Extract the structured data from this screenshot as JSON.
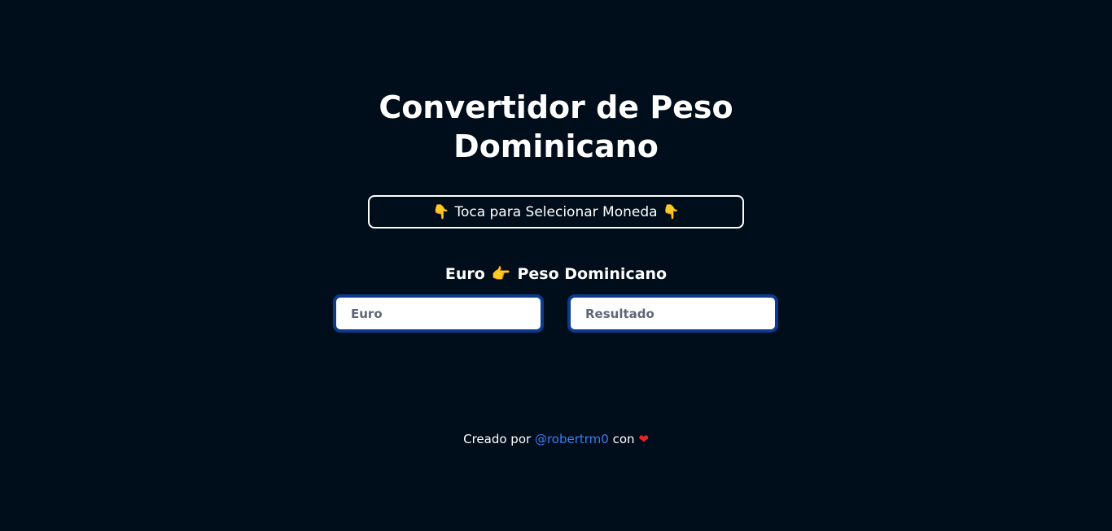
{
  "title": "Convertidor de Peso Dominicano",
  "select_button": {
    "label": "Toca para Selecionar Moneda",
    "icon": "pointing-down-hand-icon"
  },
  "conversion": {
    "from": "Euro",
    "to": "Peso Dominicano",
    "arrow_icon": "pointing-right-hand-icon"
  },
  "inputs": {
    "euro_placeholder": "Euro",
    "result_placeholder": "Resultado"
  },
  "footer": {
    "prefix": "Creado por",
    "author": "@robertrm0",
    "suffix": "con",
    "heart_icon": "heart-icon"
  },
  "colors": {
    "background": "#000d1a",
    "input_border": "#0b3a8f",
    "link": "#3d7cf0",
    "heart": "#e3242b",
    "hand": "#f5b92a"
  }
}
